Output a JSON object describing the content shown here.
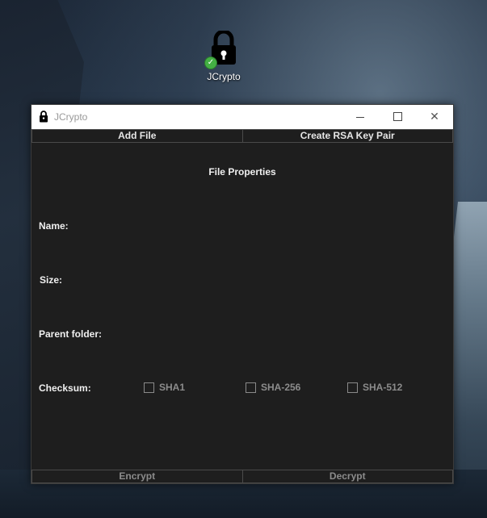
{
  "desktop": {
    "icon_label": "JCrypto"
  },
  "window": {
    "title": "JCrypto",
    "controls": {
      "minimize": "—",
      "maximize": "☐",
      "close": "✕"
    }
  },
  "toolbar": {
    "add_file": "Add File",
    "create_rsa": "Create RSA Key Pair"
  },
  "properties": {
    "heading": "File Properties",
    "name_label": "Name:",
    "size_label": "Size:",
    "parent_label": "Parent folder:",
    "checksum_label": "Checksum:",
    "checksums": [
      {
        "label": "SHA1",
        "checked": false
      },
      {
        "label": "SHA-256",
        "checked": false
      },
      {
        "label": "SHA-512",
        "checked": false
      }
    ]
  },
  "actions": {
    "encrypt": "Encrypt",
    "decrypt": "Decrypt"
  },
  "colors": {
    "window_bg": "#1e1e1e",
    "text": "#f0f0f0",
    "disabled_text": "#8c8c8c",
    "badge": "#44b044"
  }
}
